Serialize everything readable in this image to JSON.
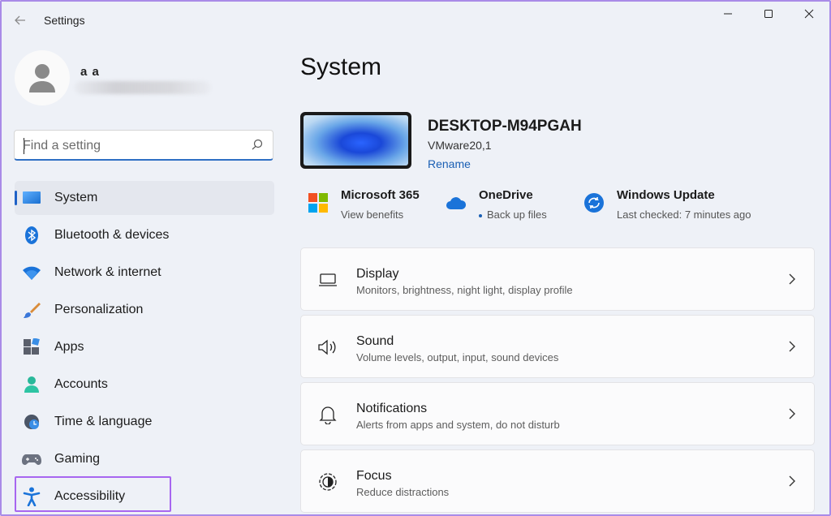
{
  "window": {
    "title": "Settings"
  },
  "user": {
    "name": "a a"
  },
  "search": {
    "placeholder": "Find a setting"
  },
  "sidebar": {
    "items": [
      {
        "label": "System",
        "icon": "system-icon",
        "active": true
      },
      {
        "label": "Bluetooth & devices",
        "icon": "bluetooth-icon"
      },
      {
        "label": "Network & internet",
        "icon": "wifi-icon"
      },
      {
        "label": "Personalization",
        "icon": "brush-icon"
      },
      {
        "label": "Apps",
        "icon": "apps-icon"
      },
      {
        "label": "Accounts",
        "icon": "person-icon"
      },
      {
        "label": "Time & language",
        "icon": "clock-globe-icon"
      },
      {
        "label": "Gaming",
        "icon": "gamepad-icon"
      },
      {
        "label": "Accessibility",
        "icon": "accessibility-icon"
      }
    ]
  },
  "main": {
    "title": "System",
    "device": {
      "name": "DESKTOP-M94PGAH",
      "model": "VMware20,1",
      "rename_label": "Rename"
    },
    "quick": [
      {
        "title": "Microsoft 365",
        "sub": "View benefits",
        "icon": "microsoft-logo-icon"
      },
      {
        "title": "OneDrive",
        "sub": "Back up files",
        "icon": "onedrive-cloud-icon"
      },
      {
        "title": "Windows Update",
        "sub": "Last checked: 7 minutes ago",
        "icon": "windows-update-icon"
      }
    ],
    "cards": [
      {
        "title": "Display",
        "sub": "Monitors, brightness, night light, display profile",
        "icon": "laptop-icon"
      },
      {
        "title": "Sound",
        "sub": "Volume levels, output, input, sound devices",
        "icon": "speaker-icon"
      },
      {
        "title": "Notifications",
        "sub": "Alerts from apps and system, do not disturb",
        "icon": "bell-icon"
      },
      {
        "title": "Focus",
        "sub": "Reduce distractions",
        "icon": "focus-icon"
      }
    ]
  },
  "colors": {
    "accent": "#1f62c7",
    "highlight": "#a766f0",
    "link": "#1a5fb4"
  }
}
